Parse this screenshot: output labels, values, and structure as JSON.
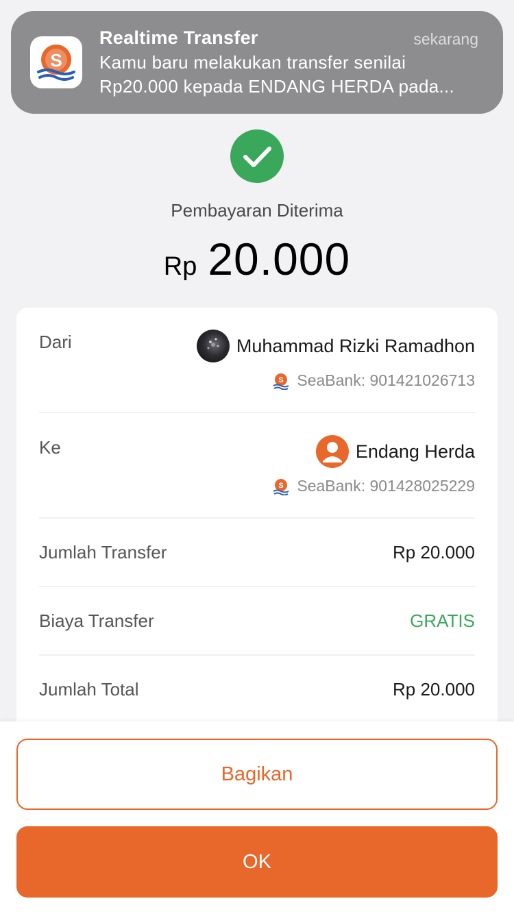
{
  "notification": {
    "app_icon": "seabank-logo-icon",
    "title": "Realtime Transfer",
    "time": "sekarang",
    "line1": "Kamu baru melakukan transfer senilai",
    "line2": "Rp20.000 kepada ENDANG HERDA pada..."
  },
  "status": {
    "icon": "check-icon",
    "text": "Pembayaran Diterima",
    "currency": "Rp",
    "amount": "20.000"
  },
  "details": {
    "from": {
      "label": "Dari",
      "name": "Muhammad Rizki Ramadhon",
      "bank": "SeaBank: 901421026713"
    },
    "to": {
      "label": "Ke",
      "name": "Endang Herda",
      "bank": "SeaBank: 901428025229"
    },
    "rows": [
      {
        "label": "Jumlah Transfer",
        "value": "Rp 20.000"
      },
      {
        "label": "Biaya Transfer",
        "value": "GRATIS"
      },
      {
        "label": "Jumlah Total",
        "value": "Rp 20.000"
      }
    ]
  },
  "actions": {
    "share_label": "Bagikan",
    "ok_label": "OK"
  },
  "colors": {
    "accent": "#e8672a",
    "success": "#3aa85b"
  }
}
